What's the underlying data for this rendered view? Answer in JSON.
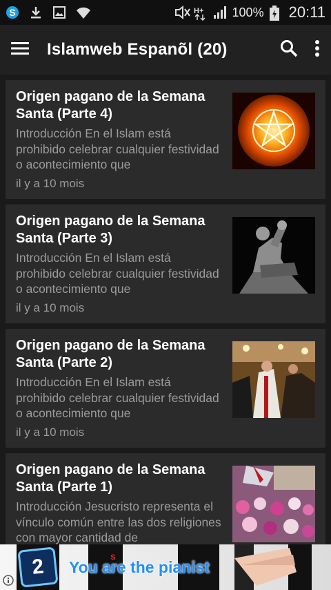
{
  "status_bar": {
    "icons_left": [
      "skype-icon",
      "download-icon",
      "image-icon",
      "wifi-icon"
    ],
    "icons_right": [
      "mute-icon",
      "h-plus-icon",
      "signal-icon"
    ],
    "battery": "100%",
    "time": "20:11"
  },
  "app_bar": {
    "title": "Islamweb Espanõl (20)",
    "icons": [
      "menu-icon",
      "search-icon",
      "more-vert-icon"
    ]
  },
  "articles": [
    {
      "title": "Origen pagano de la Semana Santa (Parte 4)",
      "excerpt": "Introducción   En el Islam está prohibido celebrar cualquier festividad o acontecimiento que",
      "time": "il y a 10 mois",
      "thumb": "pentagram-fire"
    },
    {
      "title": "Origen pagano de la Semana Santa (Parte 3)",
      "excerpt": "Introducción   En el Islam está prohibido celebrar cualquier festividad o acontecimiento que",
      "time": "il y a 10 mois",
      "thumb": "statue"
    },
    {
      "title": "Origen pagano de la Semana Santa (Parte 2)",
      "excerpt": "Introducción   En el Islam está prohibido celebrar cualquier festividad o acontecimiento que",
      "time": "il y a 10 mois",
      "thumb": "procession"
    },
    {
      "title": "Origen pagano de la Semana Santa (Parte 1)",
      "excerpt": "Introducción Jesucristo representa el vínculo común entre las dos religiones con mayor cantidad de",
      "time": "",
      "thumb": "crowd"
    }
  ],
  "ad": {
    "text": "You are the pianist",
    "logo": "2",
    "info_icon": "info-icon"
  },
  "colors": {
    "status_bg": "#101010",
    "appbar_bg": "#212121",
    "list_bg": "#1a1a1a",
    "card_bg": "#2b2b2b",
    "title": "#ffffff",
    "secondary": "#9b9b9b",
    "ad_text": "#1e90ff"
  }
}
